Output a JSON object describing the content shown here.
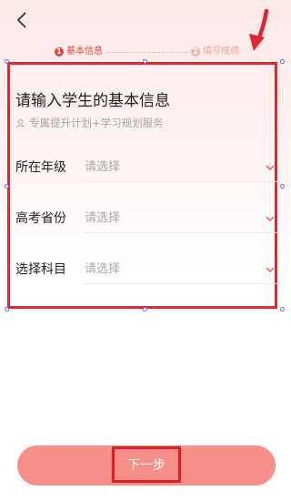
{
  "progress": {
    "steps": [
      {
        "number": "1",
        "label": "基本信息",
        "active": true
      },
      {
        "number": "2",
        "label": "填写成绩",
        "active": false
      }
    ]
  },
  "form": {
    "title": "请输入学生的基本信息",
    "subtitle": "专属提升计划+学习规划服务",
    "fields": [
      {
        "label": "所在年级",
        "placeholder": "请选择",
        "icon": "chevron-down-icon"
      },
      {
        "label": "高考省份",
        "placeholder": "请选择",
        "icon": "chevron-down-icon"
      },
      {
        "label": "选择科目",
        "placeholder": "请选择",
        "icon": "chevron-down-icon"
      }
    ]
  },
  "footer": {
    "next_label": "下一步"
  },
  "icons": {
    "back": "back-chevron-icon",
    "subtitle": "user-outline-icon",
    "annotation": "arrow-pointer-icon"
  },
  "colors": {
    "accent": "#e1443a",
    "button": "#f78f89",
    "highlight": "#e2262f",
    "handle": "#6f66d8"
  }
}
